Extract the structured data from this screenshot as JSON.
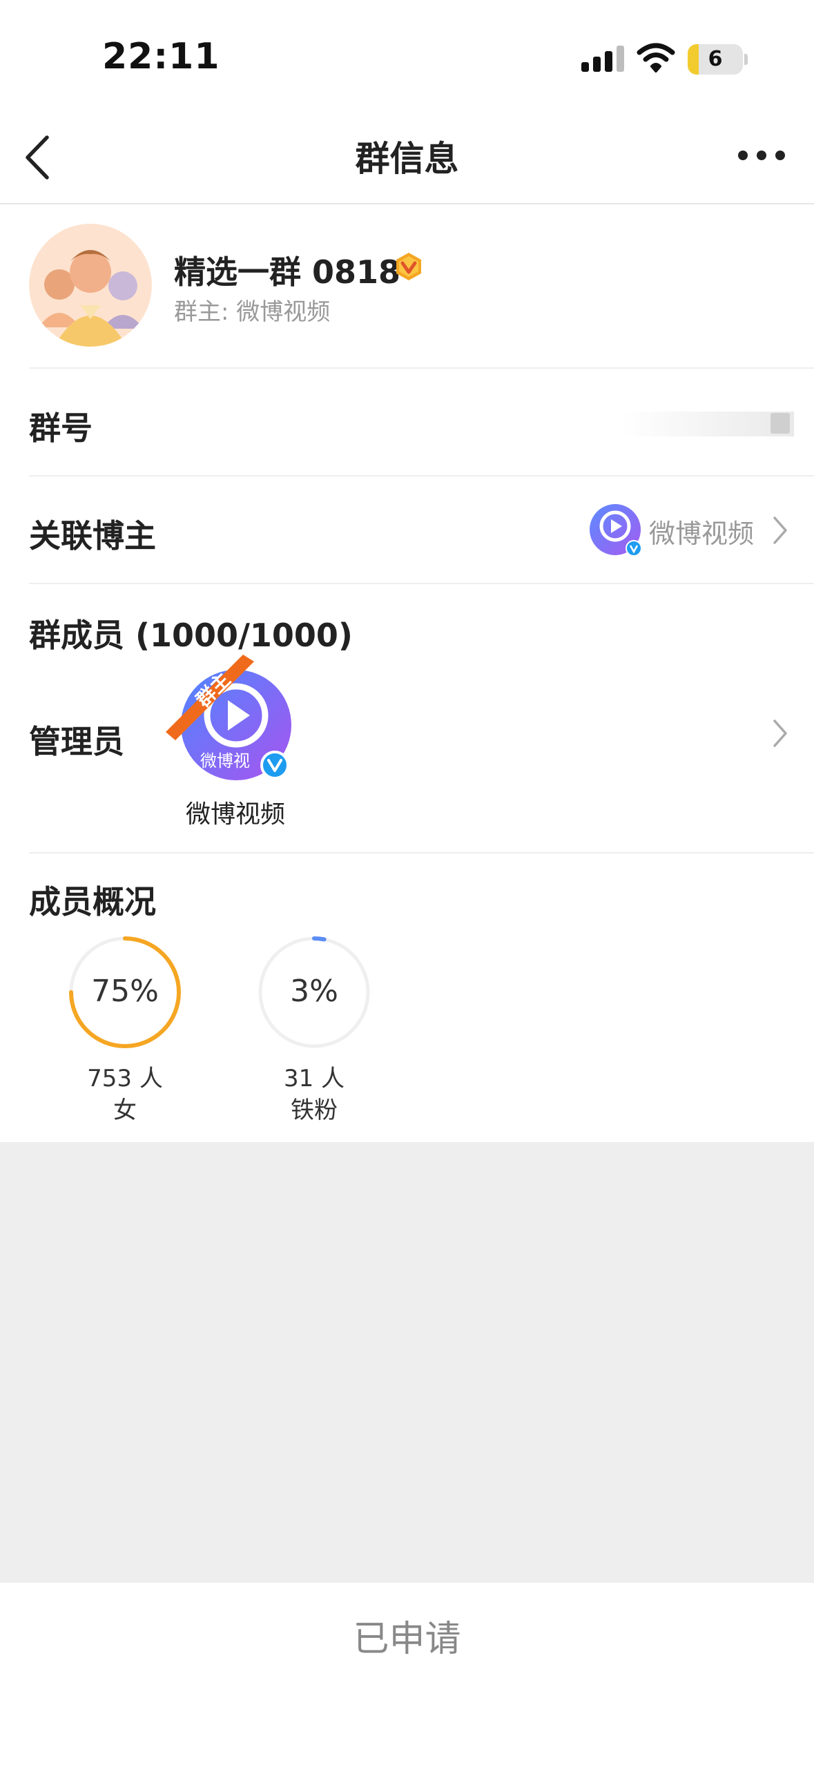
{
  "status_bar": {
    "time": "22:11",
    "battery": "6"
  },
  "nav": {
    "title": "群信息"
  },
  "group": {
    "name": "精选一群 0818",
    "owner_line": "群主: 微博视频"
  },
  "rows": {
    "group_id_label": "群号",
    "blogger_label": "关联博主",
    "blogger_name": "微博视频",
    "members_label": "群成员 (1000/1000)",
    "admin_label": "管理员",
    "admin_name": "微博视频",
    "owner_ribbon": "群主",
    "avatar_caption": "微博视"
  },
  "overview": {
    "title": "成员概况",
    "stats": [
      {
        "percent": 75,
        "percent_label": "75%",
        "count": "753 人",
        "category": "女",
        "color": "#f5a623"
      },
      {
        "percent": 3,
        "percent_label": "3%",
        "count": "31 人",
        "category": "铁粉",
        "color": "#5b8df5"
      }
    ]
  },
  "footer": {
    "button_label": "已申请"
  },
  "colors": {
    "accent_orange": "#f5a623",
    "verify_blue": "#1e9cf0",
    "ribbon_orange": "#f06a1b"
  }
}
